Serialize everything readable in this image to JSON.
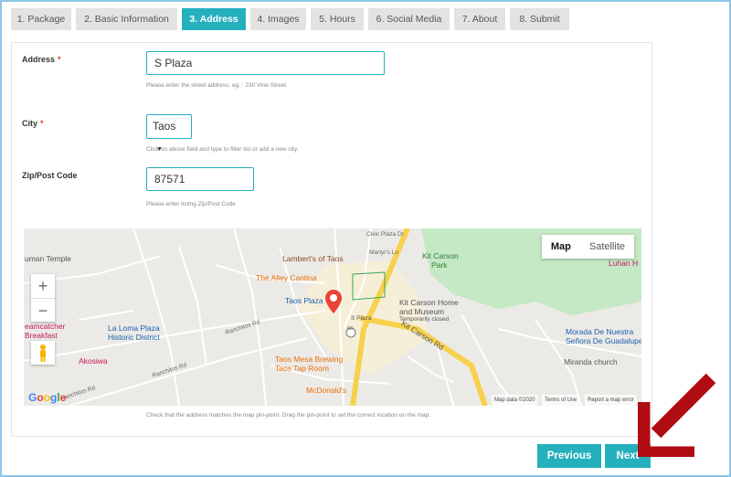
{
  "tabs": [
    {
      "label": "1. Package"
    },
    {
      "label": "2. Basic Information"
    },
    {
      "label": "3. Address"
    },
    {
      "label": "4. Images"
    },
    {
      "label": "5. Hours"
    },
    {
      "label": "6. Social Media"
    },
    {
      "label": "7. About"
    },
    {
      "label": "8. Submit"
    }
  ],
  "active_tab": "3. Address",
  "form": {
    "address": {
      "label": "Address",
      "required": "*",
      "value": "S Plaza",
      "hint": "Please enter the street address. eg. : 230 Vine Street"
    },
    "city": {
      "label": "City",
      "required": "*",
      "value": "Taos",
      "hint": "Click on above field and type to filter list or add a new city."
    },
    "zip": {
      "label": "Zip/Post Code",
      "value": "87571",
      "hint": "Please enter listing Zip/Post Code"
    }
  },
  "map": {
    "type_map": "Map",
    "type_satellite": "Satellite",
    "zoom_in": "+",
    "zoom_out": "−",
    "labels": {
      "human_temple": "uman Temple",
      "lamberts": "Lambert's of Taos",
      "alley_cantina": "The Alley Cantina",
      "taos_plaza": "Taos Plaza",
      "s_plaza": "S Plaza",
      "kit_carson_park_1": "Kit Carson",
      "kit_carson_park_2": "Park",
      "kit_carson_home_1": "Kit Carson Home",
      "kit_carson_home_2": "and Museum",
      "temporarily_closed": "Temporarily closed",
      "kit_carson_rd": "Kit Carson Rd",
      "la_loma_1": "La Loma Plaza",
      "la_loma_2": "Historic District",
      "dreamcatcher_1": "eamcatcher",
      "dreamcatcher_2": "Breakfast",
      "akosiwa": "Akosiwa",
      "ranchitos_rd_1": "Ranchitos Rd",
      "ranchitos_rd_2": "Ranchitos Rd",
      "ranchitos_rd_3": "Ranchitos Rd",
      "taos_mesa_1": "Taos Mesa Brewing",
      "taos_mesa_2": "Taos Tap Room",
      "mcdonalds": "McDonald's",
      "morada_1": "Morada De Nuestra",
      "morada_2": "Señora De Guadalupe...",
      "miranda": "Miranda church",
      "luhan": "Luhan H",
      "civic_plaza": "Civic Plaza Dr",
      "martyrs": "Martyr's Ln",
      "road_64": "68",
      "map_data": "Map data ©2020",
      "terms": "Terms of Use",
      "report": "Report a map error"
    },
    "google_letters": [
      "G",
      "o",
      "o",
      "g",
      "l",
      "e"
    ],
    "caption": "Check that the address matches the map pin-point. Drag the pin-point to set the correct location on the map."
  },
  "buttons": {
    "previous": "Previous",
    "next": "Next"
  },
  "colors": {
    "accent": "#25b0bd",
    "arrow": "#b00c12",
    "tab_bg": "#e3e3e3"
  }
}
